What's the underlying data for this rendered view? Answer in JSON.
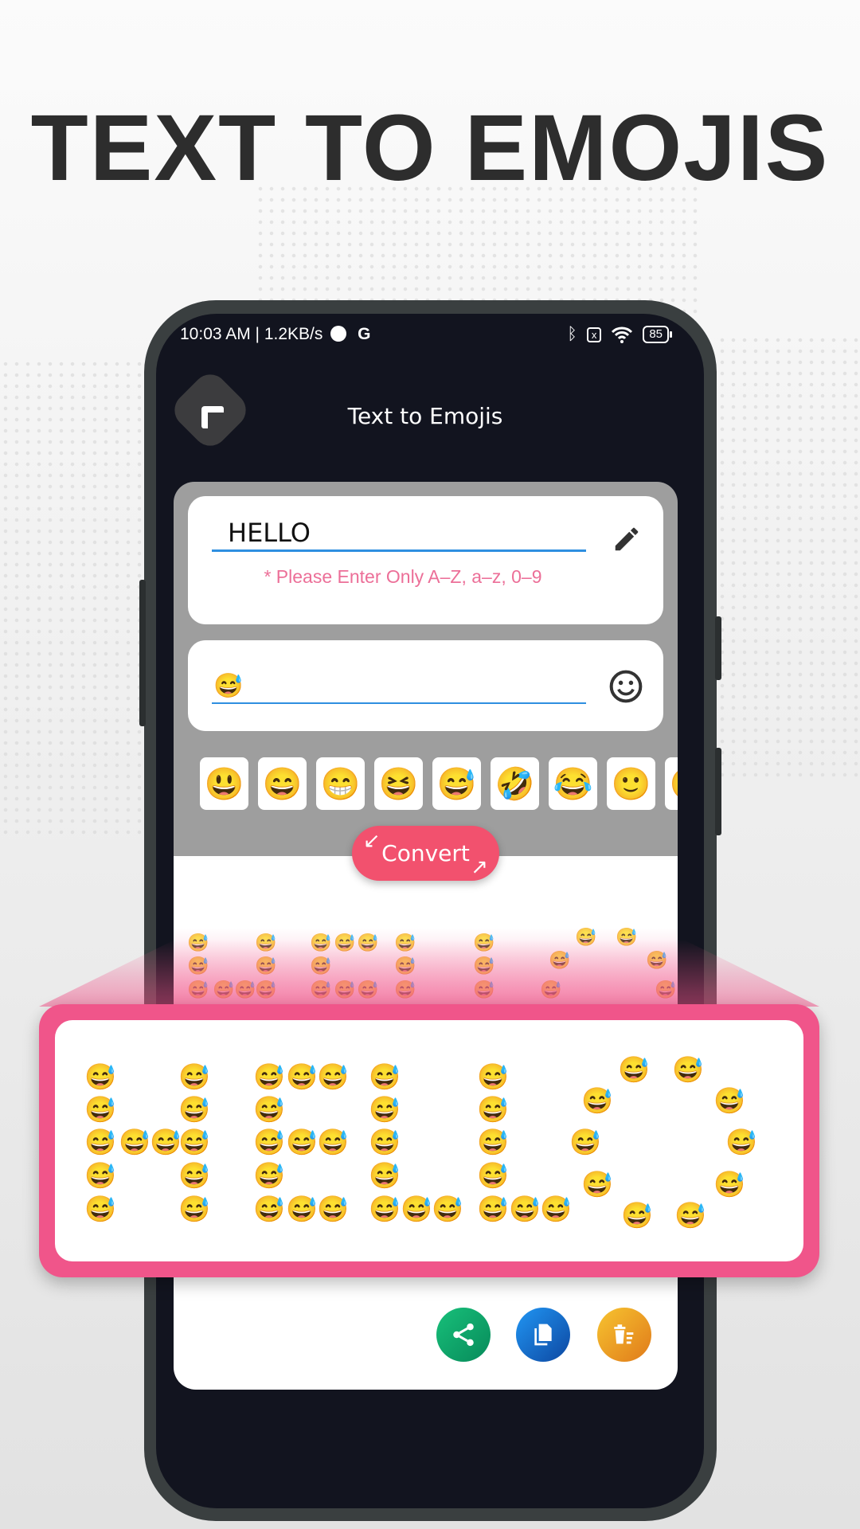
{
  "headline": "TEXT TO EMOJIS",
  "status_bar": {
    "time_speed": "10:03 AM | 1.2KB/s",
    "carrier_icon": "G",
    "battery": "85",
    "icons": [
      "vpn-icon",
      "bluetooth-icon",
      "no-sim-icon",
      "wifi-icon",
      "battery-icon"
    ]
  },
  "app": {
    "title": "Text to Emojis",
    "back_icon": "back-arrow-icon"
  },
  "input": {
    "value": "HELLO",
    "hint": "* Please Enter Only A–Z, a–z, 0–9",
    "icon": "pencil-icon"
  },
  "emoji_input": {
    "value": "😅",
    "icon": "smiley-icon"
  },
  "emoji_picker": [
    "😃",
    "😄",
    "😁",
    "😆",
    "😅",
    "🤣",
    "😂",
    "🙂",
    "🙃"
  ],
  "convert_label": "Convert",
  "output": {
    "text": "HELLO",
    "emoji": "😅"
  },
  "actions": [
    {
      "name": "share",
      "icon": "share-icon",
      "color": "#0fa968"
    },
    {
      "name": "copy",
      "icon": "copy-icon",
      "color": "#1565c0"
    },
    {
      "name": "delete",
      "icon": "delete-icon",
      "color": "#f0a020"
    }
  ],
  "colors": {
    "accent_pink": "#f0558a",
    "convert": "#f2516e",
    "hint": "#ec6f98",
    "underline": "#2e8fe0",
    "panel": "#9e9e9e"
  }
}
